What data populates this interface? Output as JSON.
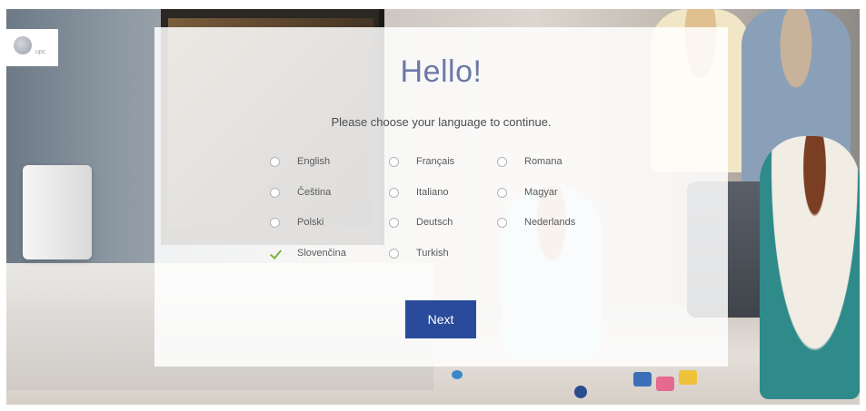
{
  "header": {
    "title": "Hello!",
    "subtitle": "Please choose your language to continue."
  },
  "logo": {
    "text": "upc"
  },
  "languages": [
    {
      "label": "English",
      "selected": false
    },
    {
      "label": "Français",
      "selected": false
    },
    {
      "label": "Romana",
      "selected": false
    },
    {
      "label": "Čeština",
      "selected": false
    },
    {
      "label": "Italiano",
      "selected": false
    },
    {
      "label": "Magyar",
      "selected": false
    },
    {
      "label": "Polski",
      "selected": false
    },
    {
      "label": "Deutsch",
      "selected": false
    },
    {
      "label": "Nederlands",
      "selected": false
    },
    {
      "label": "Slovenčina",
      "selected": true
    },
    {
      "label": "Turkish",
      "selected": false
    }
  ],
  "actions": {
    "next_label": "Next"
  },
  "colors": {
    "accent": "#2a4a9b",
    "title": "#6d79a6",
    "check": "#77b33a"
  }
}
